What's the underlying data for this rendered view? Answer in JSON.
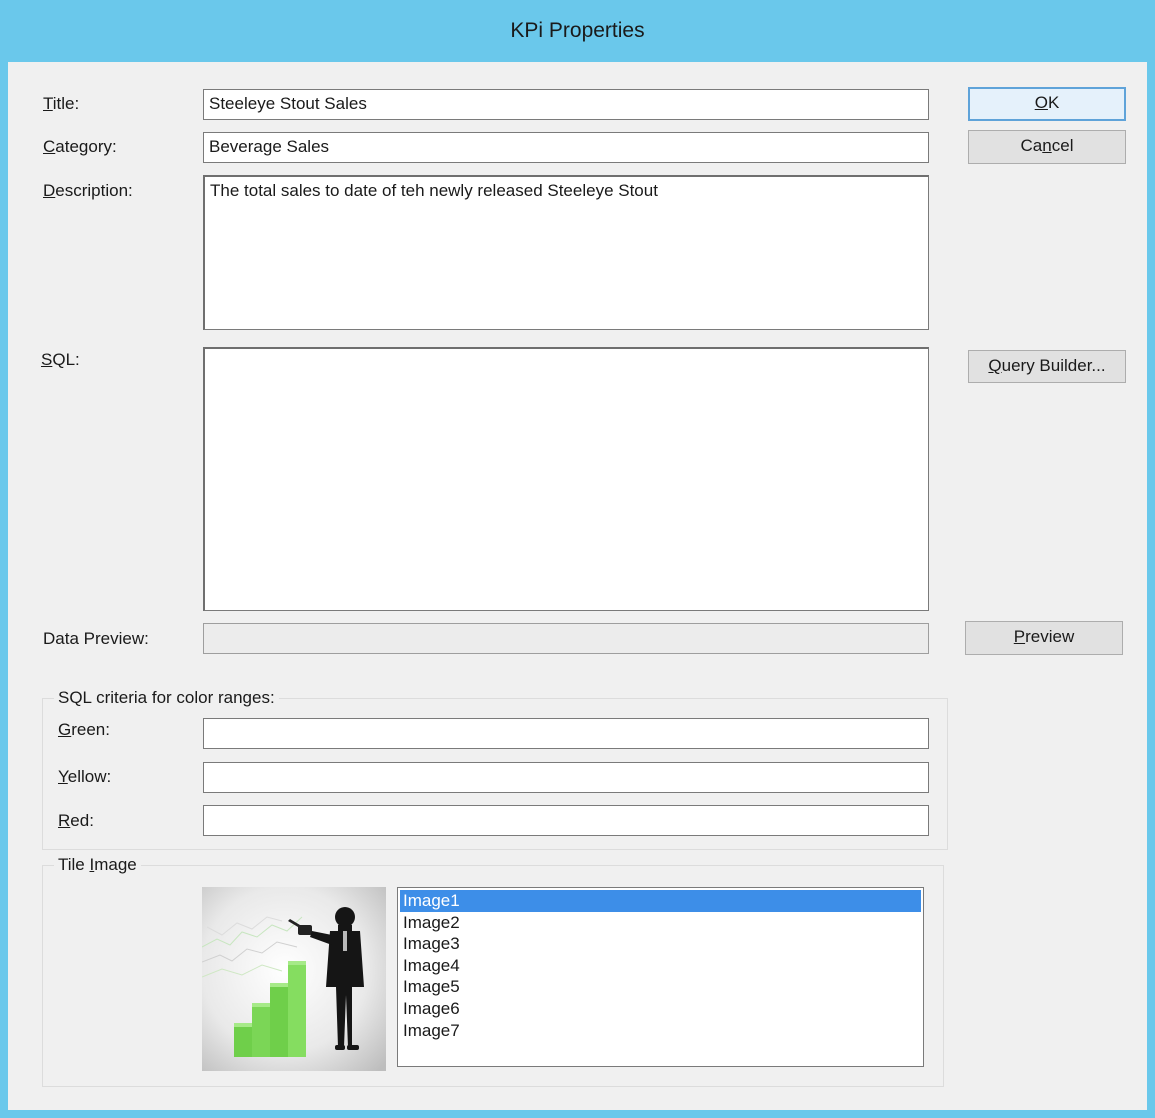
{
  "window": {
    "title": "KPi Properties"
  },
  "form": {
    "title_label_u": "T",
    "title_label_rest": "itle:",
    "title_value": "Steeleye Stout Sales",
    "category_label_u": "C",
    "category_label_rest": "ategory:",
    "category_value": "Beverage Sales",
    "description_label_u": "D",
    "description_label_rest": "escription:",
    "description_value": "The total sales to date of teh newly released Steeleye Stout",
    "sql_label_u": "S",
    "sql_label_rest": "QL:",
    "sql_value": "",
    "data_preview_label": "Data Preview:",
    "data_preview_value": ""
  },
  "buttons": {
    "ok_u": "O",
    "ok_rest": "K",
    "cancel_pre": "Ca",
    "cancel_u": "n",
    "cancel_rest": "cel",
    "query_u": "Q",
    "query_rest": "uery Builder...",
    "preview_u": "P",
    "preview_rest": "review"
  },
  "criteria": {
    "group_label": "SQL criteria for color ranges:",
    "green_u": "G",
    "green_rest": "reen:",
    "green_value": "",
    "yellow_u": "Y",
    "yellow_rest": "ellow:",
    "yellow_value": "",
    "red_u": "R",
    "red_rest": "ed:",
    "red_value": ""
  },
  "tile": {
    "group_label_pre": "Tile ",
    "group_label_u": "I",
    "group_label_rest": "mage",
    "images": [
      "Image1",
      "Image2",
      "Image3",
      "Image4",
      "Image5",
      "Image6",
      "Image7"
    ],
    "selected": "Image1"
  },
  "colors": {
    "titlebar": "#6ac8eb",
    "selection": "#3d8ee8",
    "bar_green": "#6fcf4a"
  }
}
